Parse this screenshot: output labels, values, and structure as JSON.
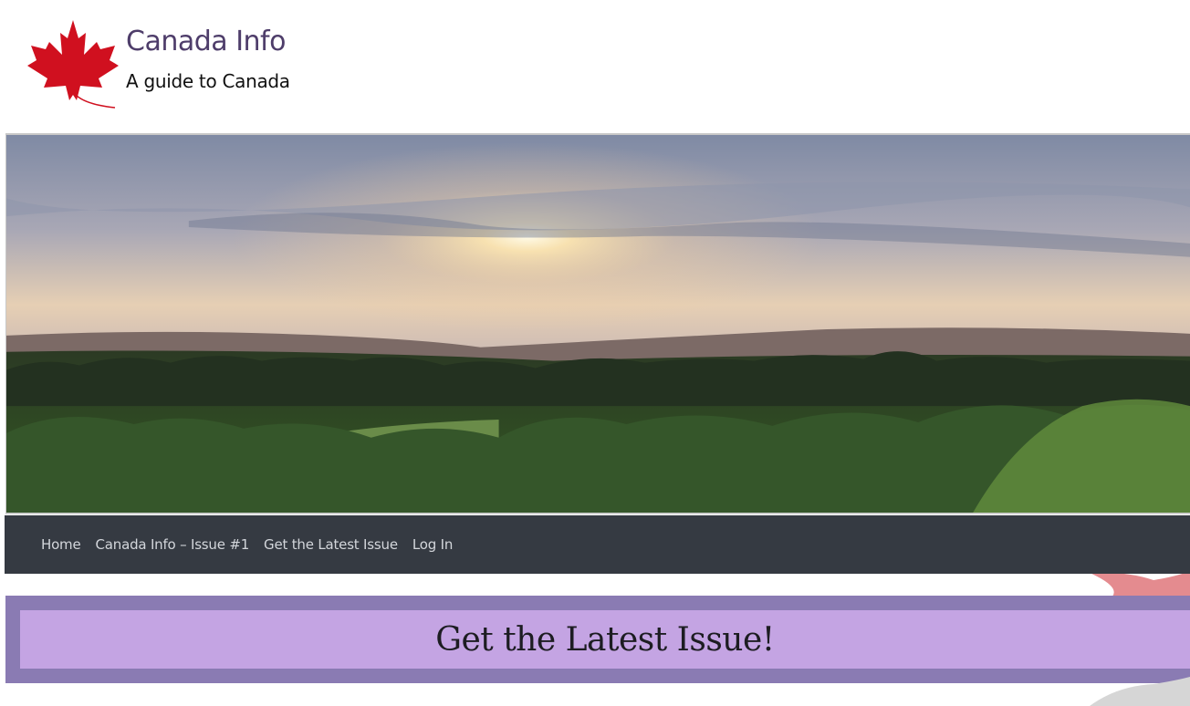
{
  "header": {
    "title": "Canada Info",
    "tagline": "A guide to Canada",
    "logo_icon": "maple-leaf-icon"
  },
  "hero": {
    "image": "sunset-over-forest-landscape"
  },
  "nav": {
    "items": [
      {
        "label": "Home"
      },
      {
        "label": "Canada Info – Issue #1"
      },
      {
        "label": "Get the Latest Issue"
      },
      {
        "label": "Log In"
      }
    ]
  },
  "banner": {
    "title": "Get the Latest Issue!"
  },
  "colors": {
    "title": "#4e3d6a",
    "nav_bg": "#353a42",
    "banner_outer": "#8a7bb3",
    "banner_inner": "#c4a4e3",
    "leaf": "#d0101f"
  }
}
